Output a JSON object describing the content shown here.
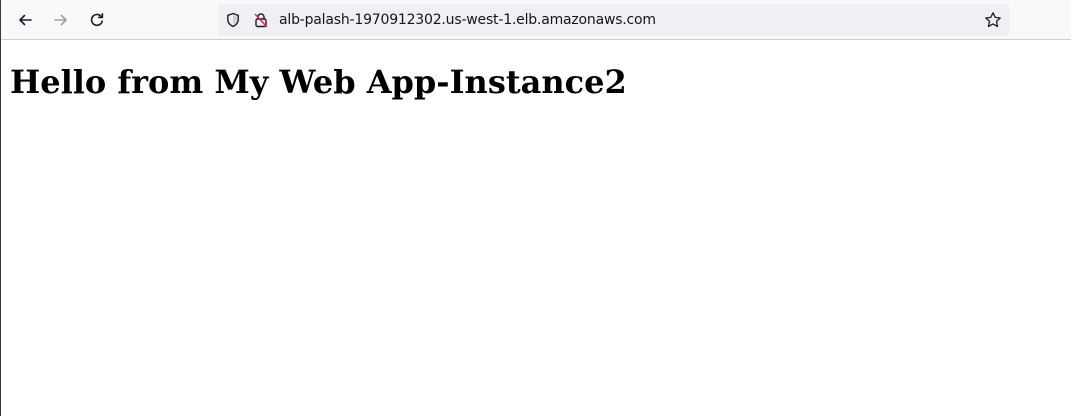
{
  "browser": {
    "url": "alb-palash-1970912302.us-west-1.elb.amazonaws.com",
    "icons": {
      "back": "arrow-left-icon",
      "forward": "arrow-right-icon",
      "reload": "reload-icon",
      "tracking_protection": "shield-icon",
      "connection": "insecure-lock-icon",
      "bookmark": "star-icon"
    },
    "colors": {
      "insecure_lock": "#e22850",
      "toolbar_bg": "#f9f9fb",
      "urlbar_bg": "#f0f0f4"
    }
  },
  "page": {
    "heading": "Hello from My Web App-Instance2"
  }
}
